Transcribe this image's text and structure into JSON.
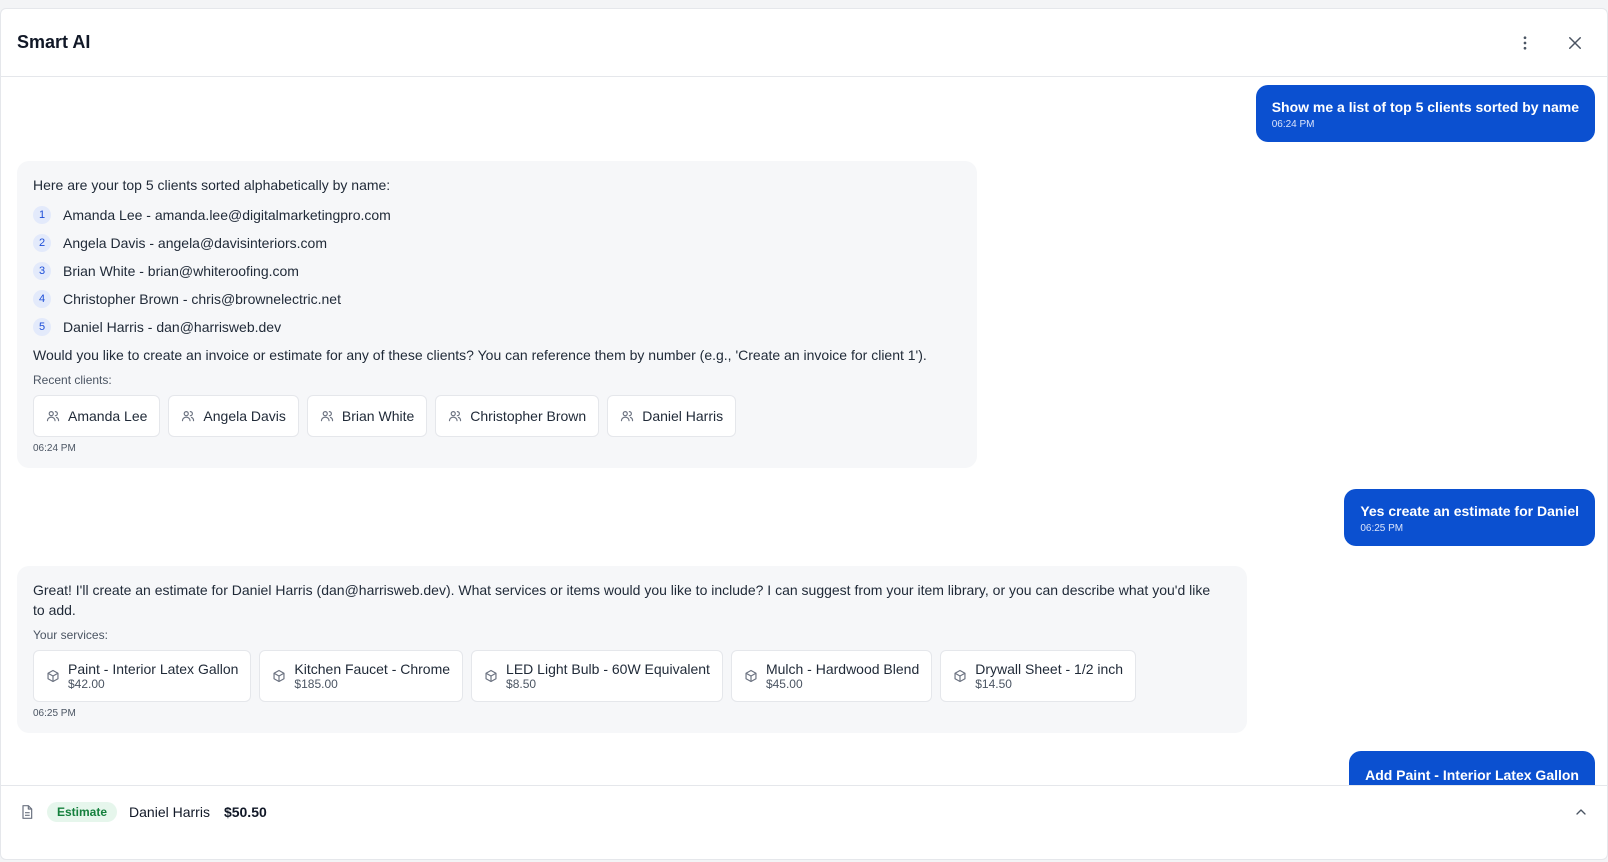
{
  "header": {
    "title": "Smart AI",
    "more_icon": "more-vertical-icon",
    "close_icon": "close-icon"
  },
  "messages": {
    "user1": {
      "text": "Show me a list of top 5 clients sorted by name",
      "time": "06:24 PM"
    },
    "bot1": {
      "intro": "Here are your top 5 clients sorted alphabetically by name:",
      "list": [
        {
          "num": "1",
          "text": "Amanda Lee - amanda.lee@digitalmarketingpro.com"
        },
        {
          "num": "2",
          "text": "Angela Davis - angela@davisinteriors.com"
        },
        {
          "num": "3",
          "text": "Brian White - brian@whiteroofing.com"
        },
        {
          "num": "4",
          "text": "Christopher Brown - chris@brownelectric.net"
        },
        {
          "num": "5",
          "text": "Daniel Harris - dan@harrisweb.dev"
        }
      ],
      "followup": "Would you like to create an invoice or estimate for any of these clients? You can reference them by number (e.g., 'Create an invoice for client 1').",
      "chips_label": "Recent clients:",
      "chips": [
        "Amanda Lee",
        "Angela Davis",
        "Brian White",
        "Christopher Brown",
        "Daniel Harris"
      ],
      "time": "06:24 PM"
    },
    "user2": {
      "text": "Yes create an estimate for Daniel",
      "time": "06:25 PM"
    },
    "bot2": {
      "text": "Great! I'll create an estimate for Daniel Harris (dan@harrisweb.dev). What services or items would you like to include? I can suggest from your item library, or you can describe what you'd like to add.",
      "chips_label": "Your services:",
      "items": [
        {
          "name": "Paint - Interior Latex Gallon",
          "price": "$42.00"
        },
        {
          "name": "Kitchen Faucet - Chrome",
          "price": "$185.00"
        },
        {
          "name": "LED Light Bulb - 60W Equivalent",
          "price": "$8.50"
        },
        {
          "name": "Mulch - Hardwood Blend",
          "price": "$45.00"
        },
        {
          "name": "Drywall Sheet - 1/2 inch",
          "price": "$14.50"
        }
      ],
      "time": "06:25 PM"
    },
    "user3": {
      "text": "Add Paint - Interior Latex Gallon"
    }
  },
  "footer": {
    "badge": "Estimate",
    "client": "Daniel Harris",
    "amount": "$50.50",
    "doc_icon": "document-icon",
    "toggle_icon": "chevron-up-icon"
  },
  "colors": {
    "accent": "#0b50d0",
    "badge_bg": "#e6f6ec",
    "badge_text": "#15803d"
  }
}
